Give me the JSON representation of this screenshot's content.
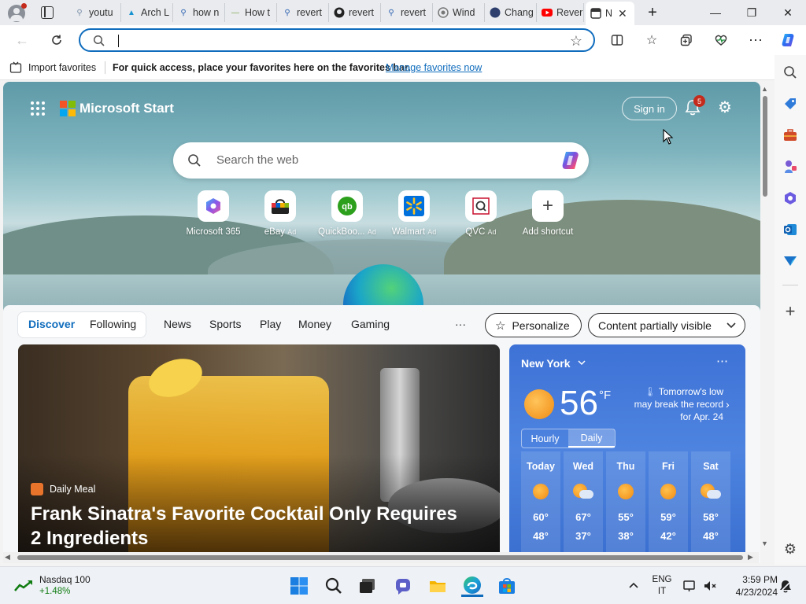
{
  "tabs": [
    {
      "label": "youtu",
      "icon": "search-icon"
    },
    {
      "label": "Arch L",
      "icon": "arch-icon"
    },
    {
      "label": "how n",
      "icon": "search-icon"
    },
    {
      "label": "How t",
      "icon": "page-icon"
    },
    {
      "label": "revert",
      "icon": "search-icon"
    },
    {
      "label": "revert",
      "icon": "github-icon"
    },
    {
      "label": "revert",
      "icon": "search-icon"
    },
    {
      "label": "Wind",
      "icon": "windows-icon"
    },
    {
      "label": "Chang",
      "icon": "page-icon"
    },
    {
      "label": "Rever",
      "icon": "youtube-icon"
    },
    {
      "label": "N",
      "icon": "page-icon"
    }
  ],
  "favorites_bar": {
    "import_label": "Import favorites",
    "message": "For quick access, place your favorites here on the favorites bar.",
    "manage_link": "Manage favorites now"
  },
  "page": {
    "brand": "Microsoft Start",
    "sign_in": "Sign in",
    "notification_count": "5",
    "search_placeholder": "Search the web",
    "shortcuts": [
      {
        "label": "Microsoft 365",
        "ad": ""
      },
      {
        "label": "eBay",
        "ad": "Ad"
      },
      {
        "label": "QuickBoo...",
        "ad": "Ad"
      },
      {
        "label": "Walmart",
        "ad": "Ad"
      },
      {
        "label": "QVC",
        "ad": "Ad"
      },
      {
        "label": "Add shortcut",
        "ad": ""
      }
    ]
  },
  "feed": {
    "tabs": [
      "Discover",
      "Following",
      "News",
      "Sports",
      "Play",
      "Money",
      "Gaming"
    ],
    "more": "···",
    "personalize": "Personalize",
    "content_visibility": "Content partially visible",
    "article": {
      "source": "Daily Meal",
      "title": "Frank Sinatra's Favorite Cocktail Only Requires 2 Ingredients"
    },
    "weather": {
      "location": "New York",
      "temp": "56",
      "unit": "°F",
      "note": "Tomorrow's low may break the record for Apr. 24",
      "toggle": [
        "Hourly",
        "Daily"
      ],
      "days": [
        {
          "day": "Today",
          "high": "60°",
          "low": "48°",
          "icon": "sunny"
        },
        {
          "day": "Wed",
          "high": "67°",
          "low": "37°",
          "icon": "partly-cloudy"
        },
        {
          "day": "Thu",
          "high": "55°",
          "low": "38°",
          "icon": "sunny"
        },
        {
          "day": "Fri",
          "high": "59°",
          "low": "42°",
          "icon": "sunny"
        },
        {
          "day": "Sat",
          "high": "58°",
          "low": "48°",
          "icon": "partly-cloudy"
        }
      ]
    }
  },
  "taskbar": {
    "stock_name": "Nasdaq 100",
    "stock_change": "+1.48%",
    "lang": "ENG",
    "region": "IT",
    "time": "3:59 PM",
    "date": "4/23/2024"
  },
  "colors": {
    "accent": "#0f6cbd",
    "weather_bg": "#3a6fd0",
    "stock_positive": "#107c10"
  }
}
